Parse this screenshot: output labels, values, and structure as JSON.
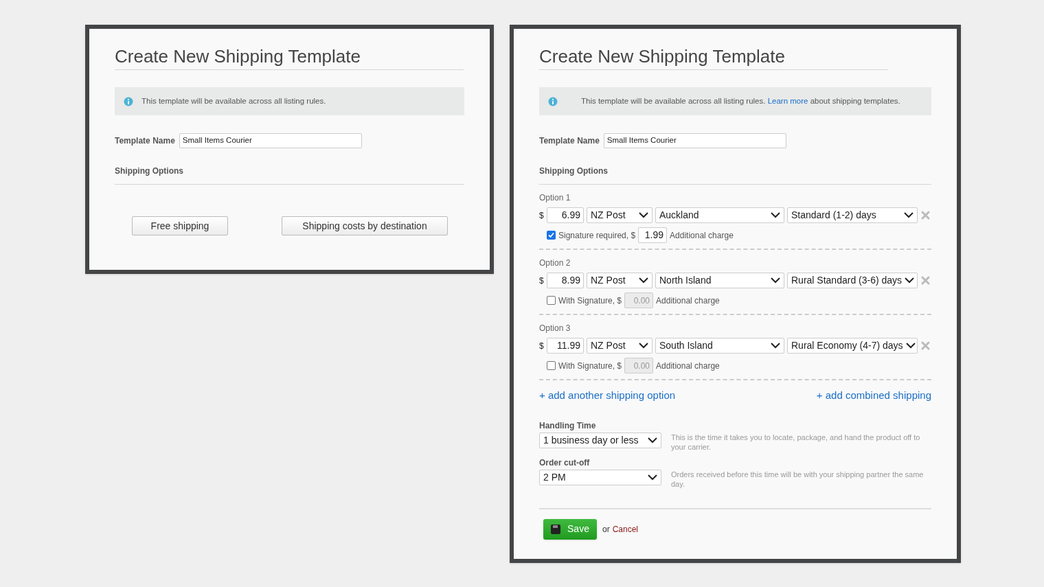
{
  "panels": [
    {
      "title": "Create New Shipping Template",
      "info": {
        "text": "This template will be available across all listing rules."
      },
      "template_name": {
        "label": "Template Name",
        "value": "Small Items Courier"
      },
      "shipping_options_label": "Shipping Options",
      "choice_buttons": [
        "Free shipping",
        "Shipping costs by destination"
      ]
    },
    {
      "title": "Create New Shipping Template",
      "info": {
        "text": "This template will be available across all listing rules.",
        "link": "Learn more",
        "text_after": "about shipping templates."
      },
      "template_name": {
        "label": "Template Name",
        "value": "Small Items Courier"
      },
      "shipping_options_label": "Shipping Options",
      "options": [
        {
          "label": "Option 1",
          "currency": "$",
          "price": "6.99",
          "carrier": "NZ Post",
          "region": "Auckland",
          "speed": "Standard (1-2) days",
          "signature": {
            "checked": true,
            "label": "Signature required, $",
            "amount": "1.99",
            "note": "Additional charge"
          }
        },
        {
          "label": "Option 2",
          "currency": "$",
          "price": "8.99",
          "carrier": "NZ Post",
          "region": "North Island",
          "speed": "Rural Standard (3-6) days",
          "signature": {
            "checked": false,
            "label": "With Signature, $",
            "amount": "0.00",
            "note": "Additional charge"
          }
        },
        {
          "label": "Option 3",
          "currency": "$",
          "price": "11.99",
          "carrier": "NZ Post",
          "region": "South Island",
          "speed": "Rural Economy (4-7) days",
          "signature": {
            "checked": false,
            "label": "With Signature, $",
            "amount": "0.00",
            "note": "Additional charge"
          }
        }
      ],
      "add_option_link": "+ add another shipping option",
      "add_combined_link": "+ add combined shipping",
      "settings": [
        {
          "label": "Handling Time",
          "value": "1 business day or less",
          "help": "This is the time it takes you to locate, package, and hand the product off to your carrier."
        },
        {
          "label": "Order cut-off",
          "value": "2 PM",
          "help": "Orders received before this time will be with your shipping partner the same day."
        }
      ],
      "save_button": "Save",
      "or_text": "or",
      "cancel_link": "Cancel"
    }
  ]
}
